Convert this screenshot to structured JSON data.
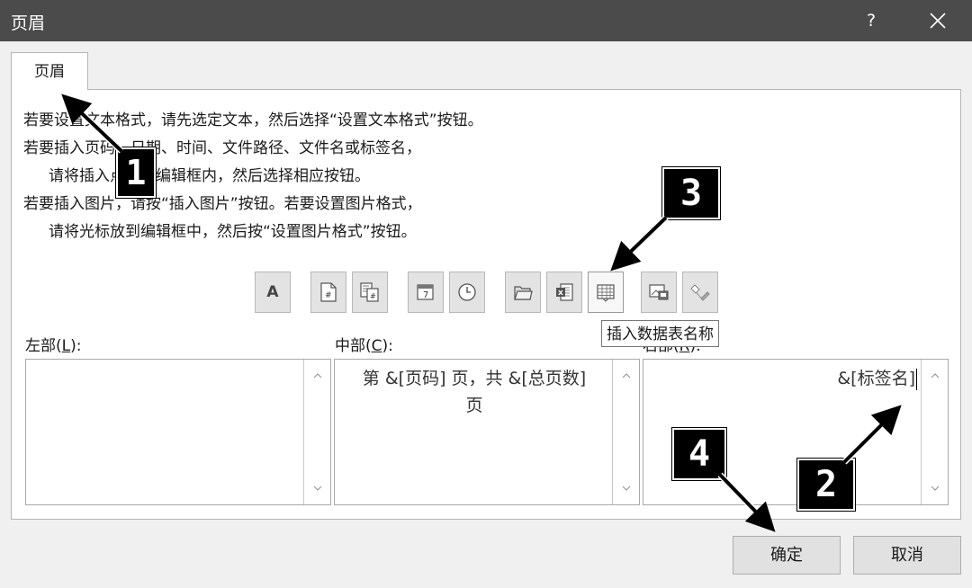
{
  "window": {
    "title": "页眉",
    "help": "?",
    "close_icon": "close-icon"
  },
  "tab": {
    "label": "页眉"
  },
  "instructions": [
    "若要设置文本格式，请先选定文本，然后选择“设置文本格式”按钮。",
    "若要插入页码、日期、时间、文件路径、文件名或标签名，",
    "请将插入点移至编辑框内，然后选择相应按钮。",
    "若要插入图片，请按“插入图片”按钮。若要设置图片格式，",
    "请将光标放到编辑框中，然后按“设置图片格式”按钮。"
  ],
  "toolbar": {
    "format_text": {
      "label": "A",
      "icon": "format-text-icon"
    },
    "page_number_icon": "page-number-icon",
    "page_count_icon": "page-count-icon",
    "date_icon": "date-icon",
    "date_label": "7",
    "time_icon": "clock-icon",
    "file_path_icon": "file-path-icon",
    "file_name_icon": "excel-file-icon",
    "file_name_letter": "x",
    "sheet_name_icon": "sheet-name-icon",
    "picture_icon": "insert-picture-icon",
    "format_picture_icon": "format-picture-icon"
  },
  "tooltip": "插入数据表名称",
  "sections": {
    "left": {
      "label": "左部(",
      "key": "L",
      "suffix": "):",
      "content": ""
    },
    "center": {
      "label": "中部(",
      "key": "C",
      "suffix": "):",
      "content_line1": "第 &[页码] 页，共 &[总页数]",
      "content_line2": "页"
    },
    "right": {
      "label": "右部(",
      "key": "R",
      "suffix": "):",
      "content": "&[标签名]"
    }
  },
  "buttons": {
    "ok": "确定",
    "cancel": "取消"
  },
  "annotations": [
    "1",
    "2",
    "3",
    "4"
  ]
}
